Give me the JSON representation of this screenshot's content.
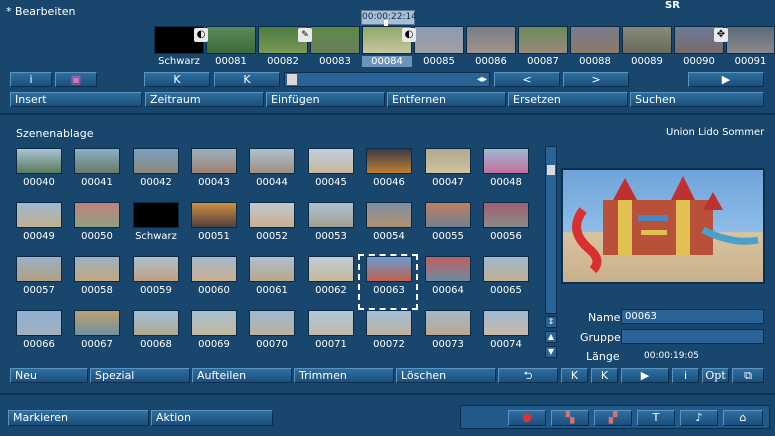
{
  "header": {
    "title": "* Bearbeiten",
    "sr_label": "SR",
    "timecode": "00:00:22:14"
  },
  "filmstrip": {
    "labels": [
      "Schwarz",
      "00081",
      "00082",
      "00083",
      "00084",
      "00085",
      "00086",
      "00087",
      "00088",
      "00089",
      "00090",
      "00091"
    ],
    "selected_index": 4
  },
  "toolbar1": {
    "info": "i",
    "goto_start": "K",
    "goto_end": "K",
    "prev": "<",
    "next": ">",
    "play": "▶"
  },
  "toolbar2": {
    "insert": "Insert",
    "zeitraum": "Zeitraum",
    "einfuegen": "Einfügen",
    "entfernen": "Entfernen",
    "ersetzen": "Ersetzen",
    "suchen": "Suchen"
  },
  "bin": {
    "title": "Szenenablage",
    "project": "Union Lido Sommer",
    "rows": [
      [
        "00040",
        "00041",
        "00042",
        "00043",
        "00044",
        "00045",
        "00046",
        "00047",
        "00048"
      ],
      [
        "00049",
        "00050",
        "Schwarz",
        "00051",
        "00052",
        "00053",
        "00054",
        "00055",
        "00056"
      ],
      [
        "00057",
        "00058",
        "00059",
        "00060",
        "00061",
        "00062",
        "00063",
        "00064",
        "00065"
      ],
      [
        "00066",
        "00067",
        "00068",
        "00069",
        "00070",
        "00071",
        "00072",
        "00073",
        "00074"
      ]
    ],
    "selected": "00063"
  },
  "info": {
    "name_label": "Name",
    "name_value": "00063",
    "gruppe_label": "Gruppe",
    "gruppe_value": "",
    "laenge_label": "Länge",
    "laenge_value": "00:00:19:05"
  },
  "bottom_toolbar": {
    "neu": "Neu",
    "spezial": "Spezial",
    "aufteilen": "Aufteilen",
    "trimmen": "Trimmen",
    "loeschen": "Löschen",
    "undo": "⮌",
    "goto_start": "K",
    "goto_end": "K",
    "play": "▶",
    "info": "i",
    "opt": "Opt"
  },
  "footer": {
    "markieren": "Markieren",
    "aktion": "Aktion"
  },
  "colors": {
    "background": "#18466c",
    "button": "#2a6496",
    "selection": "#6c93b8"
  }
}
